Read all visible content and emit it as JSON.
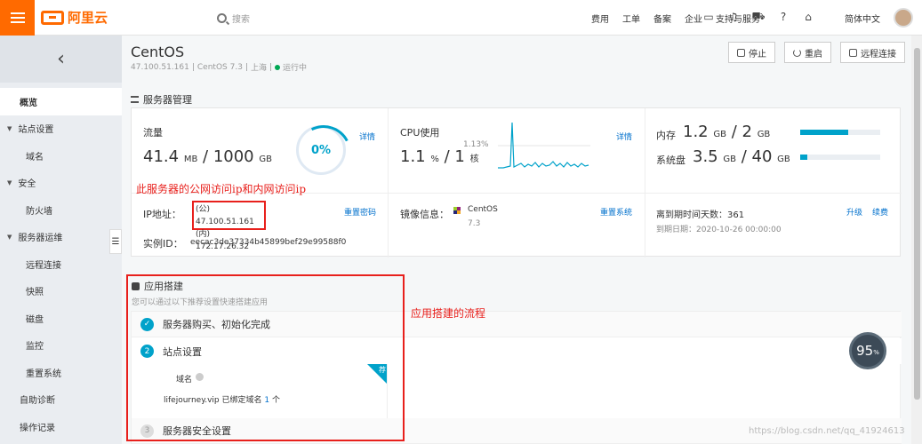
{
  "header": {
    "logo": "阿里云",
    "search_placeholder": "搜索",
    "nav": [
      "费用",
      "工单",
      "备案",
      "企业",
      "支持与服务"
    ],
    "language": "简体中文"
  },
  "sidebar": {
    "back_icon": "chevron-left",
    "items": [
      {
        "label": "概览",
        "type": "item",
        "active": true
      },
      {
        "label": "站点设置",
        "type": "group"
      },
      {
        "label": "域名",
        "type": "sub"
      },
      {
        "label": "安全",
        "type": "group"
      },
      {
        "label": "防火墙",
        "type": "sub"
      },
      {
        "label": "服务器运维",
        "type": "group"
      },
      {
        "label": "远程连接",
        "type": "sub"
      },
      {
        "label": "快照",
        "type": "sub"
      },
      {
        "label": "磁盘",
        "type": "sub"
      },
      {
        "label": "监控",
        "type": "sub"
      },
      {
        "label": "重置系统",
        "type": "sub"
      },
      {
        "label": "自助诊断",
        "type": "item"
      },
      {
        "label": "操作记录",
        "type": "item"
      }
    ]
  },
  "server": {
    "name": "CentOS",
    "ip": "47.100.51.161",
    "os": "CentOS 7.3",
    "region": "上海",
    "status": "运行中"
  },
  "actions": {
    "stop": "停止",
    "restart": "重启",
    "remote": "远程连接"
  },
  "section_title": "服务器管理",
  "traffic": {
    "label": "流量",
    "used": "41.4",
    "used_unit": "MB",
    "total": "1000",
    "total_unit": "GB",
    "percent": "0%",
    "detail": "详情"
  },
  "cpu": {
    "label": "CPU使用",
    "peak": "1.13%",
    "value": "1.1",
    "unit": "%",
    "cores": "1",
    "cores_unit": "核",
    "detail": "详情"
  },
  "memory": {
    "label": "内存",
    "used": "1.2",
    "total": "2",
    "unit": "GB",
    "fill": 0.6
  },
  "disk": {
    "label": "系统盘",
    "used": "3.5",
    "total": "40",
    "unit": "GB",
    "fill": 0.09
  },
  "network": {
    "ip_label": "IP地址：",
    "public_ip": "(公) 47.100.51.161",
    "private_ip": "(内) 172.17.26.32",
    "reset_pwd": "重置密码",
    "instance_label": "实例ID：",
    "instance_id": "eecac3de37334b45899bef29e99588f0"
  },
  "image": {
    "label": "镜像信息：",
    "name": "CentOS",
    "version": "7.3",
    "reset_sys": "重置系统"
  },
  "expiry": {
    "label": "离到期时间天数：",
    "days": "361",
    "upgrade": "升级",
    "renew": "续费",
    "date_label": "到期日期：",
    "date": "2020-10-26 00:00:00"
  },
  "annotations": {
    "ip_note": "此服务器的公网访问ip和内网访问ip",
    "flow_note": "应用搭建的流程"
  },
  "apps": {
    "title": "应用搭建",
    "desc": "您可以通过以下推荐设置快速搭建应用",
    "steps": [
      {
        "num": "✓",
        "label": "服务器购买、初始化完成"
      },
      {
        "num": "2",
        "label": "站点设置"
      },
      {
        "num": "3",
        "label": "服务器安全设置"
      }
    ],
    "domain_label": "域名",
    "domain_text": "lifejourney.vip 已绑定域名",
    "domain_count": "1",
    "domain_unit": "个",
    "tag": "荐"
  },
  "score": {
    "value": "95",
    "unit": "%"
  },
  "watermark": "https://blog.csdn.net/qq_41924613",
  "colors": {
    "brand": "#ff6a00",
    "accent": "#00a2ca",
    "annotation": "#e8201c",
    "running": "#00a854"
  }
}
